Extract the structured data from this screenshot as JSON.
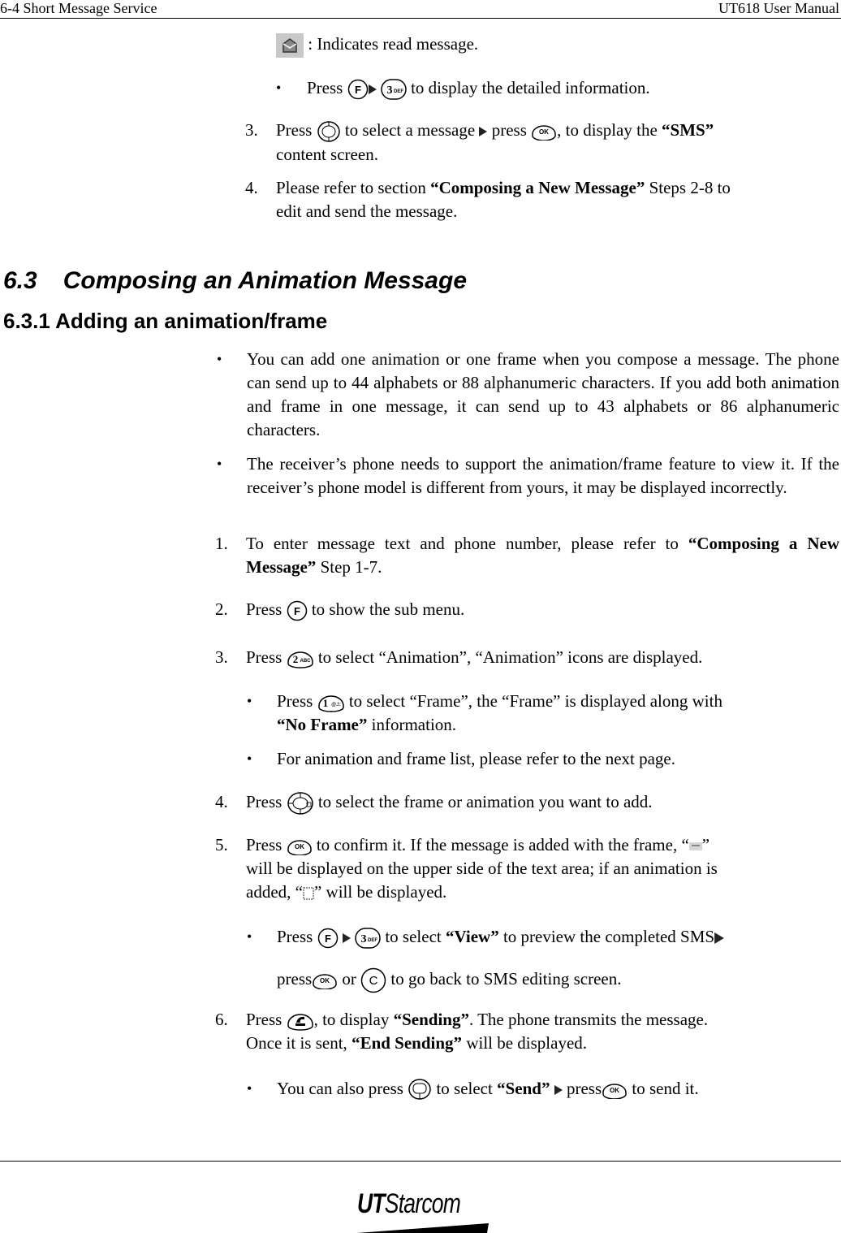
{
  "header": {
    "section": "6-4   Short Message Service",
    "manual": "UT618 User Manual"
  },
  "top": {
    "read_message_note": ": Indicates read message.",
    "bullet_press": "Press",
    "bullet_detail_tail": " to display the detailed information.",
    "step3_num": "3.",
    "step3_a": "Press",
    "step3_b": " to select a message ",
    "step3_c": " press ",
    "step3_d": ", to display the ",
    "step3_bold": "“SMS”",
    "step3_e": "content screen.",
    "step4_num": "4.",
    "step4_a": "Please refer to section ",
    "step4_bold": "“Composing a New Message”",
    "step4_b": " Steps 2-8 to",
    "step4_c": "edit and send the message."
  },
  "section": {
    "number": "6.3",
    "title": "Composing an Animation Message",
    "sub_number": "6.3.1",
    "sub_title": "Adding an animation/frame"
  },
  "intro_bullets": [
    "You can add one animation or one frame when you compose a message. The phone can send up to 44 alphabets or 88 alphanumeric characters. If you add both animation and frame in one message, it can send up to 43 alphabets or 86 alphanumeric characters.",
    "The receiver’s phone  needs to support the animation/frame feature to view it. If the receiver’s phone model is different from yours, it may be displayed incorrectly."
  ],
  "steps": {
    "s1_num": "1.",
    "s1_a": "To enter message text and phone number, please refer to ",
    "s1_bold": "“Composing a New Message”",
    "s1_b": " Step 1-7.",
    "s2_num": "2.",
    "s2_a": "Press",
    "s2_b": " to show the sub menu.",
    "s3_num": "3.",
    "s3_a": "Press",
    "s3_b": " to select “Animation”, “Animation” icons are displayed.",
    "s3_bullet1_a": "Press",
    "s3_bullet1_b": " to select “Frame”, the “Frame” is displayed along with",
    "s3_bullet1_bold": "“No Frame”",
    "s3_bullet1_c": " information.",
    "s3_bullet2": "For animation and frame list, please refer to the next page.",
    "s4_num": "4.",
    "s4_a": "Press",
    "s4_b": " to select the frame or animation you want to add.",
    "s5_num": "5.",
    "s5_a": "Press",
    "s5_b": " to confirm it. If the message is added with the frame, “",
    "s5_c": "”",
    "s5_d": "will be displayed on the upper side of the text area; if an animation is",
    "s5_e": "added, “",
    "s5_f": "” will be displayed.",
    "s5_bullet_a": "Press",
    "s5_bullet_b": " to select ",
    "s5_bullet_bold": "“View”",
    "s5_bullet_c": " to preview the completed SMS",
    "s5_bullet_d": "press",
    "s5_bullet_e": " or ",
    "s5_bullet_f": " to go back to SMS editing screen.",
    "s6_num": "6.",
    "s6_a": "Press",
    "s6_b": ", to display ",
    "s6_bold1": "“Sending”",
    "s6_c": ". The phone transmits the message.",
    "s6_d": "Once it is sent, ",
    "s6_bold2": "“End Sending”",
    "s6_e": " will be displayed.",
    "s6_bullet_a": "You can also press",
    "s6_bullet_b": " to select ",
    "s6_bullet_bold": "“Send”",
    "s6_bullet_c": " press",
    "s6_bullet_d": " to send it."
  },
  "keys": {
    "f": "F",
    "three": "3",
    "three_sub": "DEF",
    "two": "2",
    "two_sub": "ABC",
    "one": "1",
    "one_sub": "@.!:",
    "ok": "OK",
    "c": "C"
  },
  "footer": {
    "logo_bold": "UT",
    "logo_rest": "Starcom"
  },
  "bullet_glyph": "•"
}
